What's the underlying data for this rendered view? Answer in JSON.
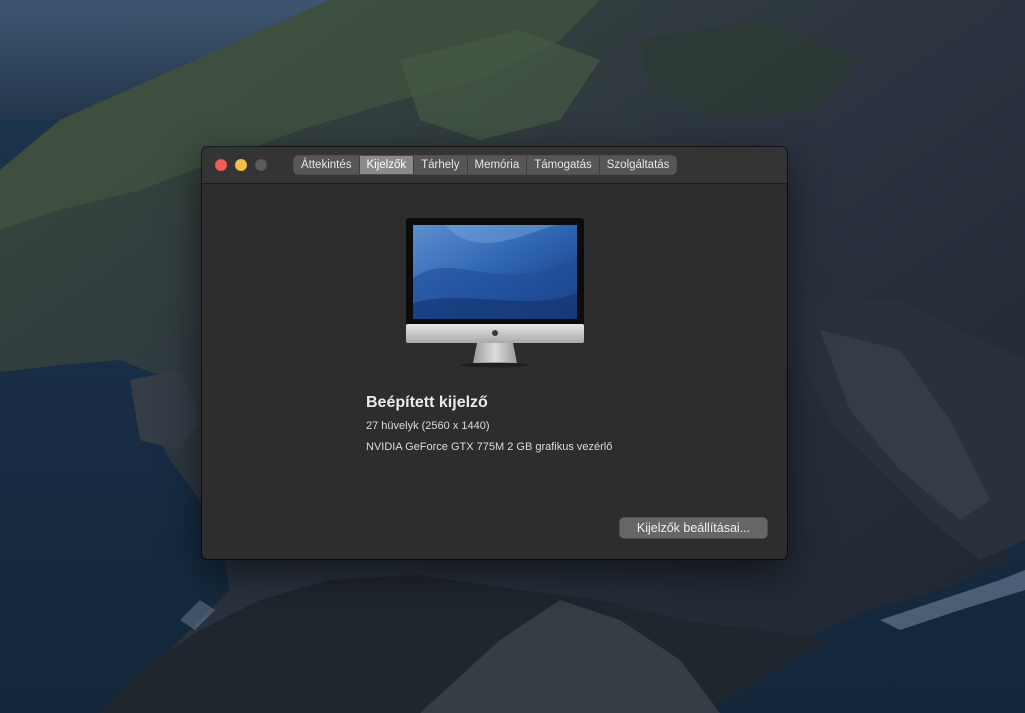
{
  "window": {
    "tabs": [
      {
        "label": "Áttekintés",
        "active": false
      },
      {
        "label": "Kijelzők",
        "active": true
      },
      {
        "label": "Tárhely",
        "active": false
      },
      {
        "label": "Memória",
        "active": false
      },
      {
        "label": "Támogatás",
        "active": false
      },
      {
        "label": "Szolgáltatás",
        "active": false
      }
    ]
  },
  "display": {
    "name": "Beépített kijelző",
    "size": "27 hüvelyk (2560 x 1440)",
    "graphics": "NVIDIA GeForce GTX 775M 2 GB grafikus vezérlő"
  },
  "actions": {
    "settings_label": "Kijelzők beállításai..."
  },
  "icons": {
    "close": "close-icon",
    "minimize": "minimize-icon",
    "zoom": "zoom-icon",
    "computer": "imac-icon",
    "wallpaper": "macos-catalina-wallpaper"
  },
  "colors": {
    "close": "#ec5f57",
    "minimize": "#f4bf4f",
    "zoom_disabled": "#5b5b5b",
    "window_bg": "#2d2d2d"
  }
}
